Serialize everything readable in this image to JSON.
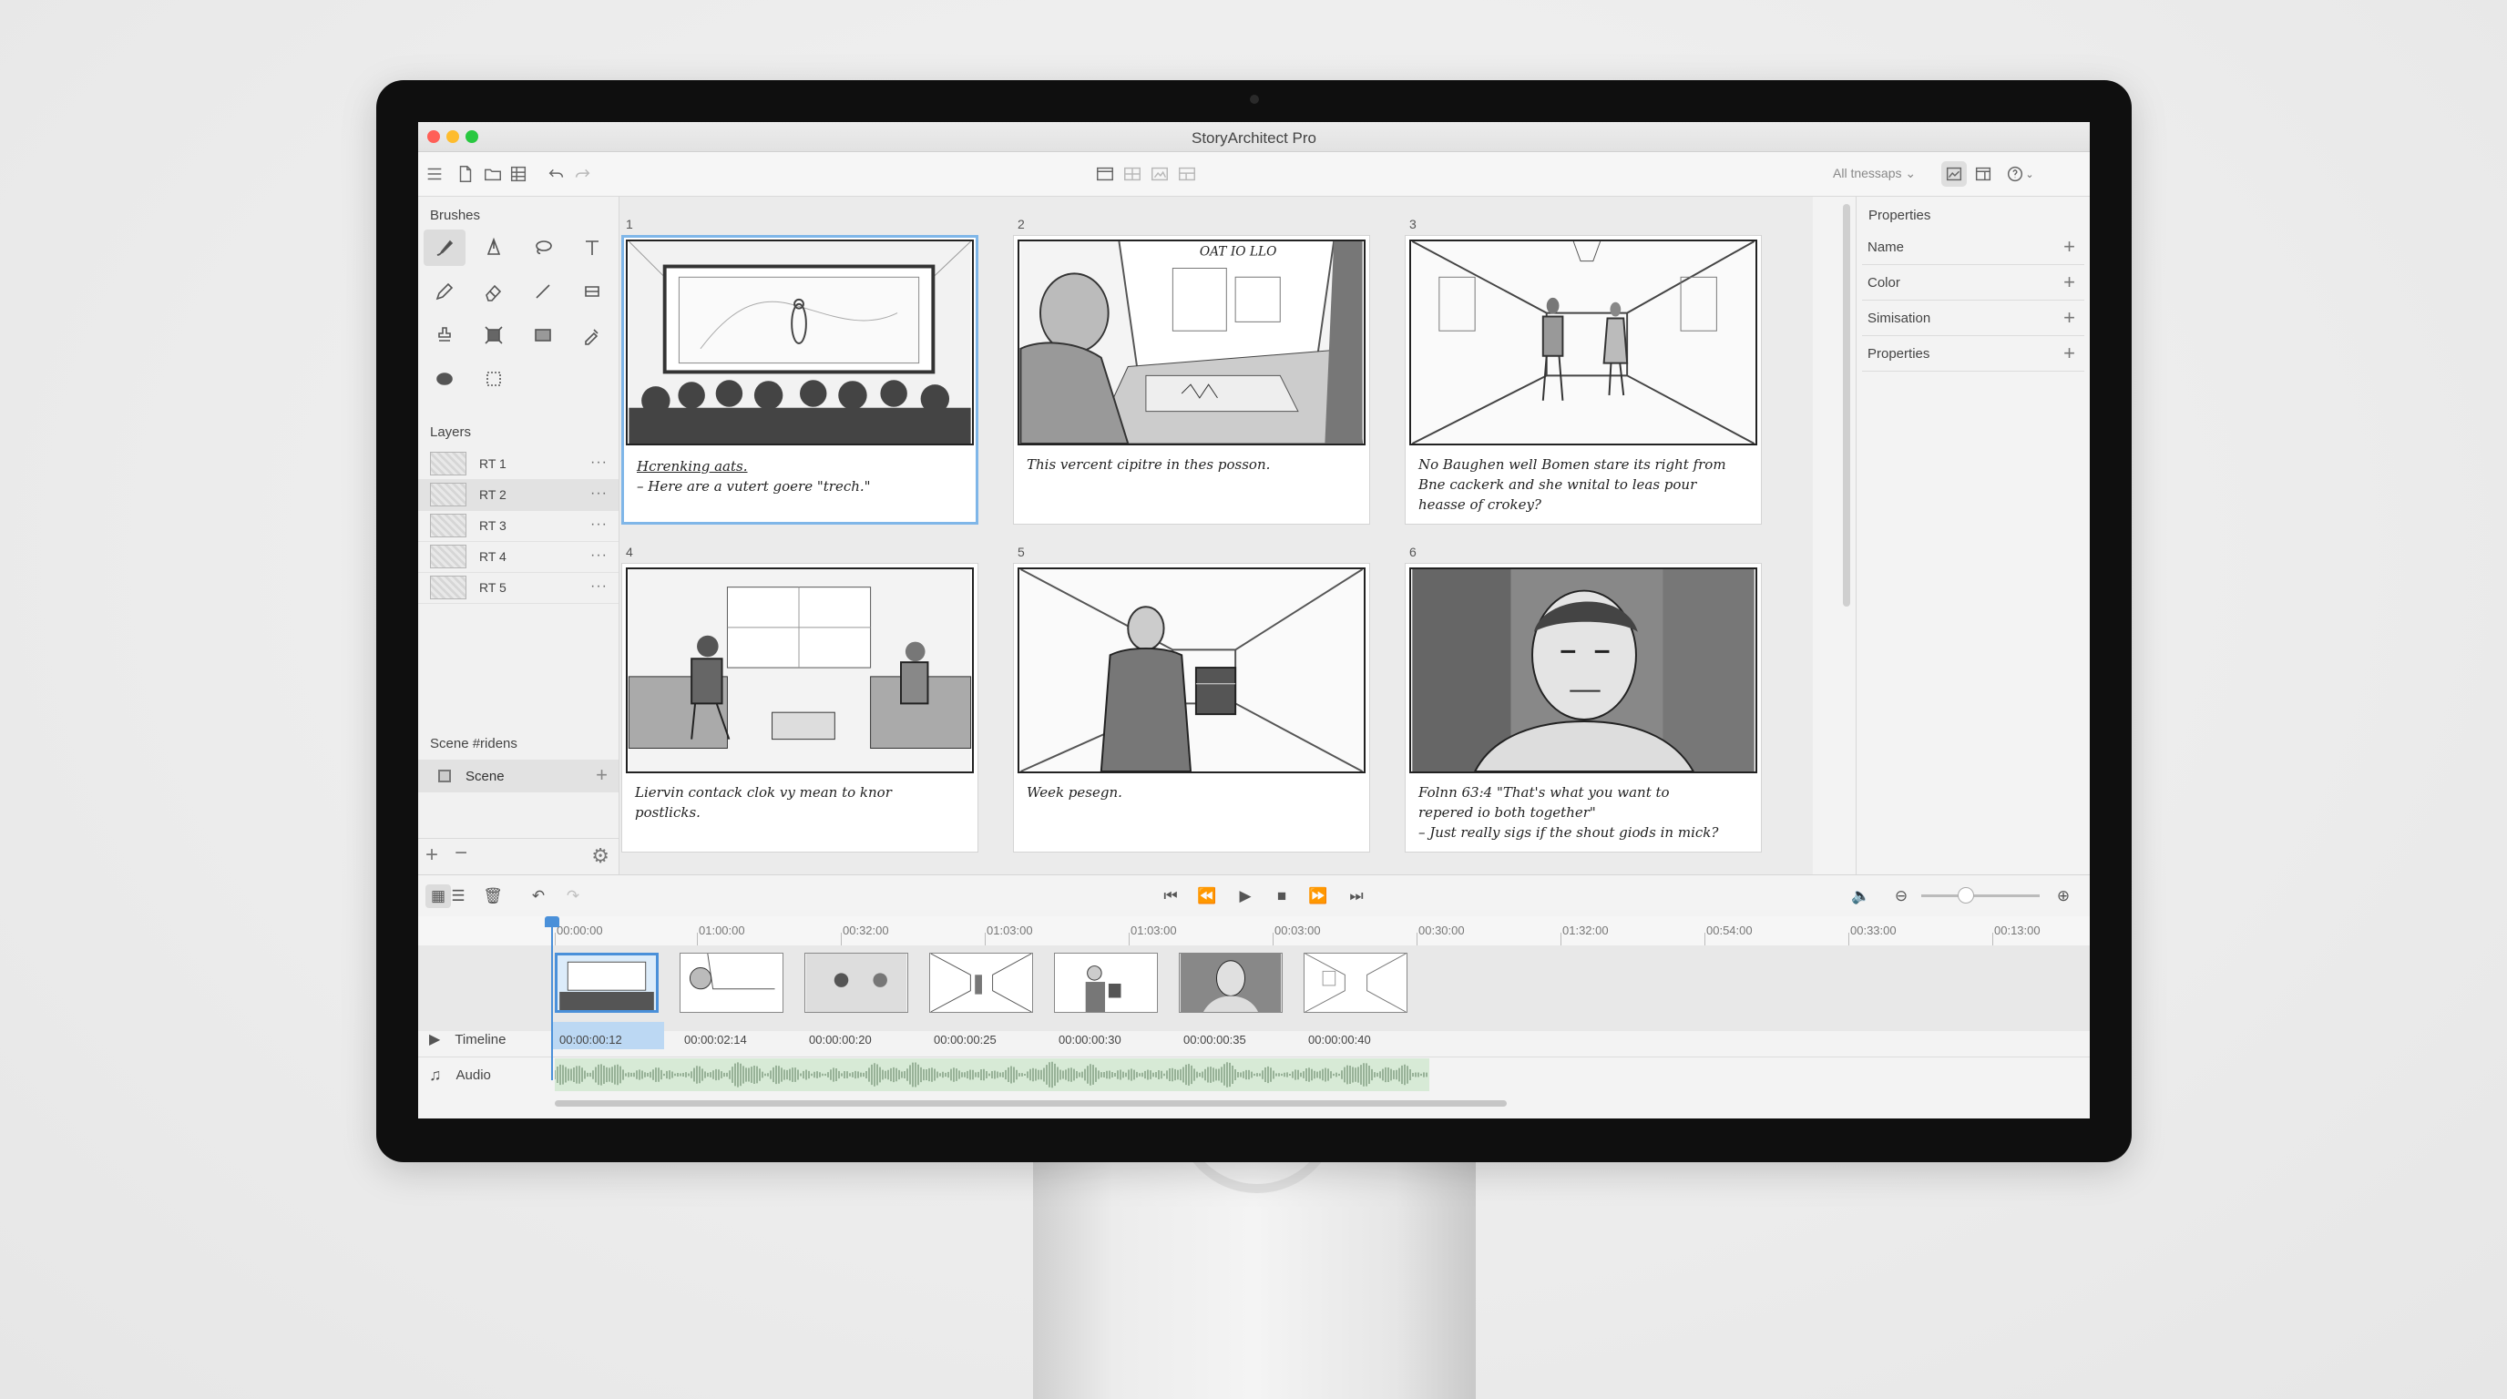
{
  "window": {
    "title": "StoryArchitect Pro"
  },
  "toolbar": {
    "layouts_dropdown": "All tnessaps"
  },
  "brushes": {
    "header": "Brushes"
  },
  "layers": {
    "header": "Layers",
    "items": [
      {
        "label": "RT 1"
      },
      {
        "label": "RT 2"
      },
      {
        "label": "RT 3"
      },
      {
        "label": "RT 4"
      },
      {
        "label": "RT 5"
      }
    ],
    "more": "···"
  },
  "scene_section": {
    "header": "Scene #ridens",
    "scene_label": "Scene"
  },
  "panels": [
    {
      "number": "1",
      "caption_lines": [
        "Hcrenking aats.",
        "– Here are a vutert goere \"trech.\""
      ]
    },
    {
      "number": "2",
      "caption_lines": [
        "This vercent cipitre in thes posson."
      ]
    },
    {
      "number": "3",
      "caption_lines": [
        "No Baughen well Bomen stare its right from",
        "Bne cackerk and she wnital to leas pour",
        "heasse of crokey?"
      ]
    },
    {
      "number": "4",
      "caption_lines": [
        "Liervin contack clok vy mean to knor",
        "postlicks."
      ]
    },
    {
      "number": "5",
      "caption_lines": [
        "Week pesegn."
      ]
    },
    {
      "number": "6",
      "caption_lines": [
        "Folnn 63:4 \"That's what you want to",
        "repered io both together\"",
        "– Just really sigs if the shout giods in mick?"
      ]
    }
  ],
  "panel_2_sign": "OAT IO   LLO",
  "properties": {
    "header": "Properties",
    "rows": [
      {
        "label": "Name"
      },
      {
        "label": "Color"
      },
      {
        "label": "Simisation"
      },
      {
        "label": "Properties"
      }
    ]
  },
  "timeline": {
    "ruler": [
      "00:00:00",
      "01:00:00",
      "00:32:00",
      "01:03:00",
      "01:03:00",
      "00:03:00",
      "00:30:00",
      "01:32:00",
      "00:54:00",
      "00:33:00",
      "00:13:00"
    ],
    "clip_times": [
      "00:00:00:12",
      "00:00:02:14",
      "00:00:00:20",
      "00:00:00:25",
      "00:00:00:30",
      "00:00:00:35",
      "00:00:00:40"
    ],
    "tracks": {
      "timeline_label": "Timeline",
      "audio_label": "Audio"
    }
  },
  "colors": {
    "selection": "#7fb6e8",
    "playhead": "#4a90d9",
    "audio_fill": "#d7ead6"
  }
}
